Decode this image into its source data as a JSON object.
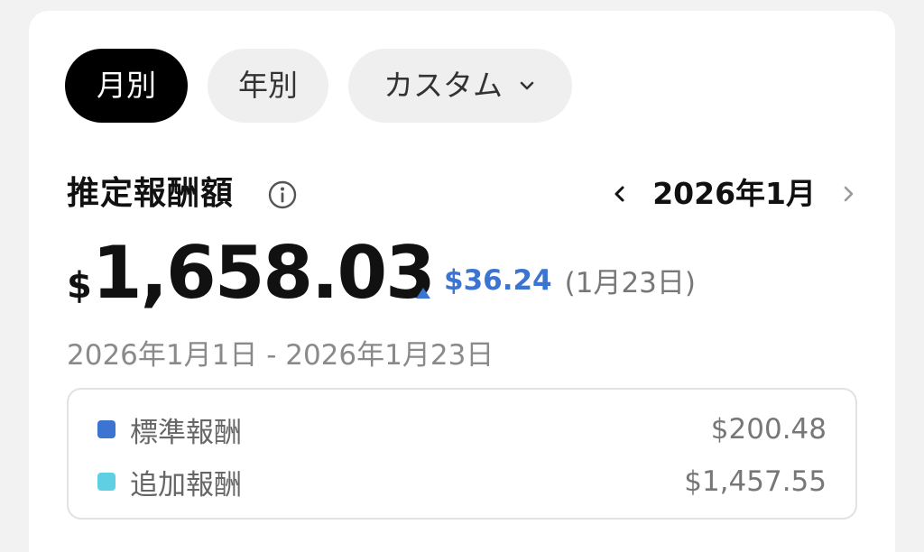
{
  "tabs": [
    {
      "label": "月別",
      "active": true
    },
    {
      "label": "年別",
      "active": false
    },
    {
      "label": "カスタム",
      "active": false
    }
  ],
  "header": {
    "title": "推定報酬額",
    "info_icon": "info-icon",
    "month": "2026年1月",
    "prev_icon": "chevron-left-icon",
    "next_icon": "chevron-right-icon"
  },
  "summary": {
    "currency": "$",
    "amount": "1,658.03",
    "delta": "$36.24",
    "delta_date": "(1月23日)",
    "delta_color": "#3b74d1",
    "range": "2026年1月1日 - 2026年1月23日"
  },
  "breakdown": [
    {
      "label": "標準報酬",
      "value": "$200.48",
      "color": "#3b74d1"
    },
    {
      "label": "追加報酬",
      "value": "$1,457.55",
      "color": "#5fcfe3"
    }
  ]
}
